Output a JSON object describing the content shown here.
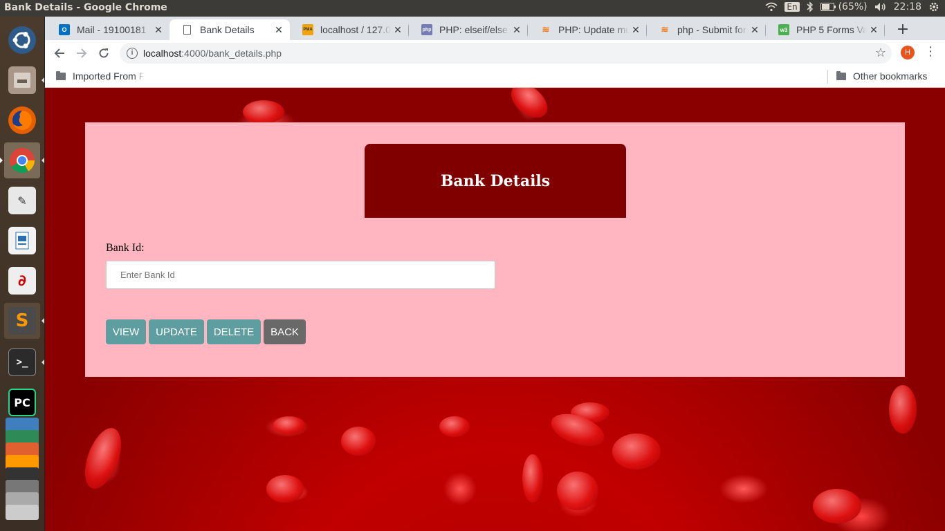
{
  "os": {
    "window_title": "Bank Details - Google Chrome",
    "input_lang": "En",
    "battery": "(65%)",
    "clock": "22:18"
  },
  "launcher": {
    "apps": [
      {
        "name": "ubuntu-dash",
        "glyph": "◎",
        "color": "#2f5b8a"
      },
      {
        "name": "files",
        "glyph": "▭",
        "color": "#8a7a6a"
      },
      {
        "name": "firefox",
        "glyph": "🦊",
        "color": "#e66000"
      },
      {
        "name": "chrome",
        "glyph": "◉",
        "color": "#4285f4"
      },
      {
        "name": "text-editor",
        "glyph": "✎",
        "color": "#d8d8d8"
      },
      {
        "name": "libreoffice-writer",
        "glyph": "W",
        "color": "#2a6fb4"
      },
      {
        "name": "document-viewer",
        "glyph": "∂",
        "color": "#ddd"
      },
      {
        "name": "sublime-text",
        "glyph": "S",
        "color": "#ff9800"
      },
      {
        "name": "terminal",
        "glyph": ">_",
        "color": "#2b2b2b"
      },
      {
        "name": "pycharm",
        "glyph": "PC",
        "color": "#21d789"
      }
    ]
  },
  "browser": {
    "tabs": [
      {
        "label": "Mail - 19100181",
        "favicon": "O",
        "favicon_color": "#0072c6"
      },
      {
        "label": "Bank Details",
        "favicon": "",
        "favicon_color": "#ffffff"
      },
      {
        "label": "localhost / 127.0",
        "favicon": "PMA",
        "favicon_color": "#f0a30a"
      },
      {
        "label": "PHP: elseif/else",
        "favicon": "php",
        "favicon_color": "#777bb3"
      },
      {
        "label": "PHP: Update mu",
        "favicon": "S",
        "favicon_color": "#f48024"
      },
      {
        "label": "php - Submit for",
        "favicon": "S",
        "favicon_color": "#f48024"
      },
      {
        "label": "PHP 5 Forms Va",
        "favicon": "w3",
        "favicon_color": "#4caf50"
      }
    ],
    "url_host": "localhost",
    "url_rest": ":4000/bank_details.php",
    "profile_initial": "H",
    "bookmarks": {
      "left": "Imported From F",
      "right": "Other bookmarks"
    }
  },
  "page": {
    "heading": "Bank Details",
    "form": {
      "bank_id_label": "Bank Id:",
      "bank_id_value": "",
      "bank_id_placeholder": "Enter Bank Id"
    },
    "buttons": {
      "view": "VIEW",
      "update": "UPDATE",
      "delete": "DELETE",
      "back": "BACK"
    },
    "colors": {
      "panel": "#ffb6c1",
      "header": "#800000",
      "action_button": "#5f9ea0",
      "back_button": "#696969"
    }
  }
}
